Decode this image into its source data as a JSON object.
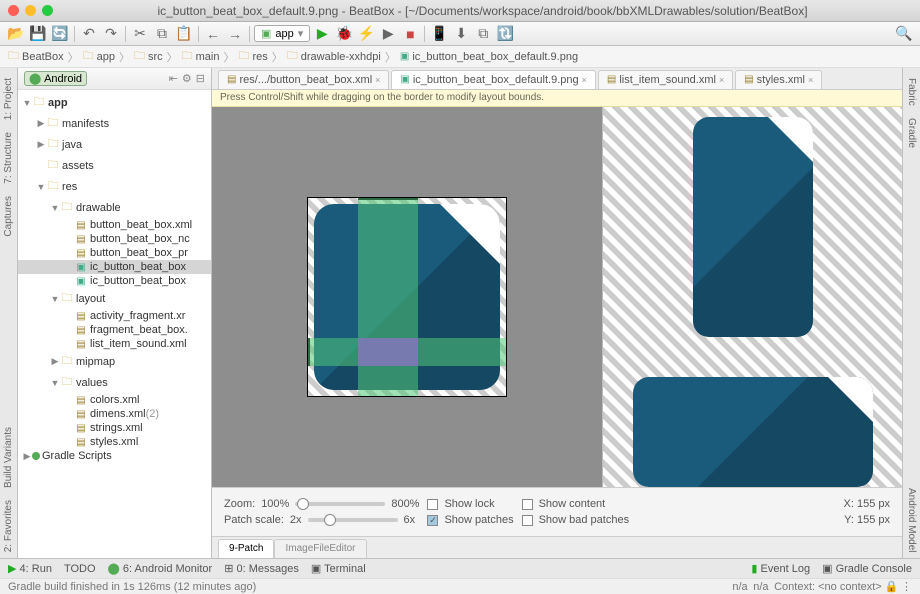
{
  "window": {
    "title": "ic_button_beat_box_default.9.png - BeatBox - [~/Documents/workspace/android/book/bbXMLDrawables/solution/BeatBox]"
  },
  "runConfig": "app",
  "breadcrumbs": [
    "BeatBox",
    "app",
    "src",
    "main",
    "res",
    "drawable-xxhdpi",
    "ic_button_beat_box_default.9.png"
  ],
  "projectSelector": "Android",
  "tree": {
    "app": "app",
    "manifests": "manifests",
    "java": "java",
    "assets": "assets",
    "res": "res",
    "drawable": "drawable",
    "d1": "button_beat_box.xml",
    "d2": "button_beat_box_nc",
    "d3": "button_beat_box_pr",
    "d4": "ic_button_beat_box",
    "d5": "ic_button_beat_box",
    "layout": "layout",
    "l1": "activity_fragment.xr",
    "l2": "fragment_beat_box.",
    "l3": "list_item_sound.xml",
    "mipmap": "mipmap",
    "values": "values",
    "v1": "colors.xml",
    "v2": "dimens.xml",
    "v2b": "(2)",
    "v3": "strings.xml",
    "v4": "styles.xml",
    "gradle": "Gradle Scripts"
  },
  "tabs": [
    {
      "label": "res/.../button_beat_box.xml",
      "active": false
    },
    {
      "label": "ic_button_beat_box_default.9.png",
      "active": true
    },
    {
      "label": "list_item_sound.xml",
      "active": false
    },
    {
      "label": "styles.xml",
      "active": false
    }
  ],
  "hint": "Press Control/Shift while dragging on the border to modify layout bounds.",
  "controls": {
    "zoomLabel": "Zoom:",
    "zoomVal": "100%",
    "zoomMax": "800%",
    "patchLabel": "Patch scale:",
    "patchVal": "2x",
    "patchMax": "6x",
    "showLock": "Show lock",
    "showPatches": "Show patches",
    "showContent": "Show content",
    "showBad": "Show bad patches",
    "xLabel": "X: 155 px",
    "yLabel": "Y: 155 px"
  },
  "edTabs": {
    "a": "9-Patch",
    "b": "ImageFileEditor"
  },
  "bottom": {
    "run": "4: Run",
    "todo": "TODO",
    "monitor": "6: Android Monitor",
    "messages": "0: Messages",
    "terminal": "Terminal",
    "eventLog": "Event Log",
    "gradleConsole": "Gradle Console"
  },
  "status": {
    "msg": "Gradle build finished in 1s 126ms (12 minutes ago)",
    "na": "n/a",
    "ctx": "Context: <no context>"
  },
  "sideTools": {
    "project": "1: Project",
    "structure": "7: Structure",
    "captures": "Captures",
    "variants": "Build Variants",
    "favorites": "2: Favorites",
    "fabric": "Fabric",
    "gradle": "Gradle",
    "model": "Android Model"
  },
  "menuDots": "⋮"
}
